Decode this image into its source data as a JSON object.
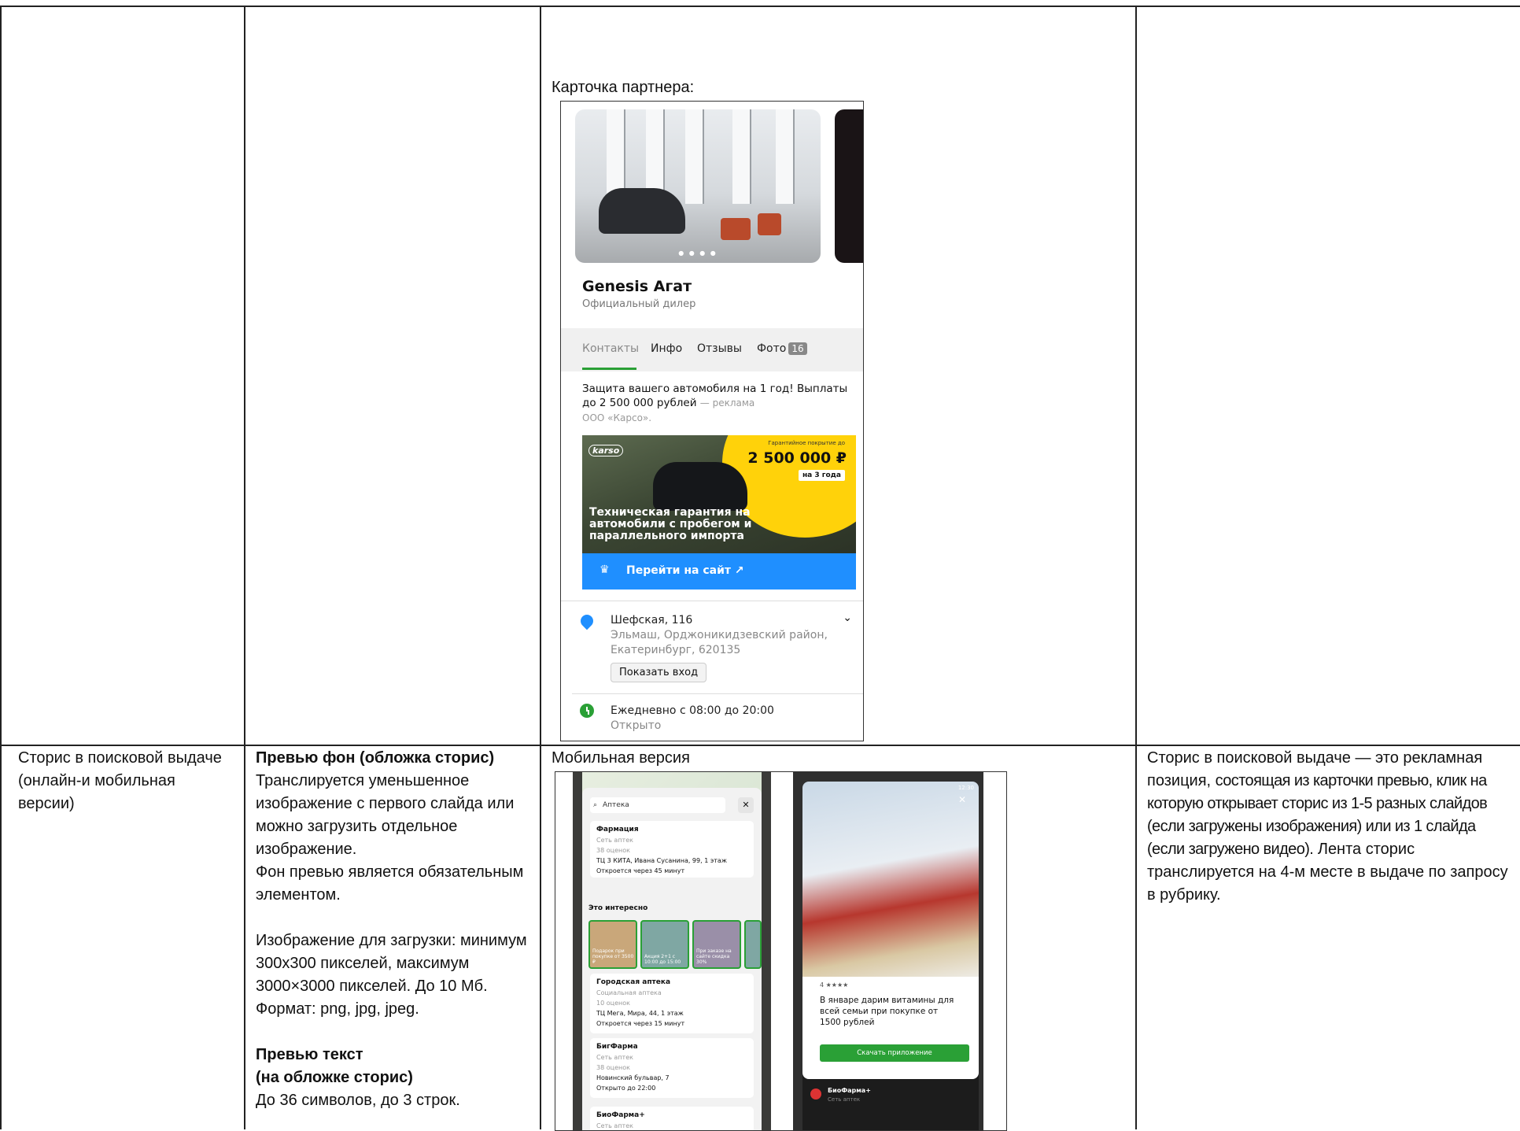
{
  "partner_card_label": "Карточка партнера:",
  "partner": {
    "photo_dots": "● ● ● ●",
    "name": "Genesis Агат",
    "subtitle": "Официальный дилер",
    "tabs": [
      "Контакты",
      "Инфо",
      "Отзывы",
      "Фото"
    ],
    "photo_count": "16",
    "ad_text": "Защита вашего автомобиля на 1 год! Выплаты до 2 500 000 рублей",
    "ad_mark": "— реклама",
    "ad_org": "ООО «Карсо».",
    "banner": {
      "logo": "karso",
      "coverage_label": "Гарантийное покрытие до",
      "sum": "2 500 000 ₽",
      "years": "на 3 года",
      "headline": "Техническая гарантия на автомобили с пробегом и параллельного импорта"
    },
    "cta_label": "Перейти на сайт ↗",
    "address_main": "Шефская, 116",
    "address_sub": "Эльмаш, Орджоникидзевский район, Екатеринбург, 620135",
    "show_entry": "Показать вход",
    "hours": "Ежедневно с 08:00 до 20:00",
    "status": "Открыто"
  },
  "row": {
    "col1": "Сторис в поисковой выдаче (онлайн-и мобильная версии)",
    "col2": {
      "h1": "Превью фон (обложка сторис)",
      "p1": "Транслируется уменьшенное изображение с первого слайда или можно загрузить отдельное изображение.",
      "p2": "Фон превью является обязательным элементом.",
      "p3": "Изображение для загрузки: минимум 300x300 пикселей, максимум 3000×3000 пикселей. До 10 Мб. Формат: png, jpg, jpeg.",
      "h2": "Превью текст",
      "h3": "(на обложке сторис)",
      "p4": "До 36 символов, до 3 строк."
    },
    "col3_label": "Мобильная версия",
    "col4_a": "Сторис в поисковой выдаче — это",
    "col4_b": "рекламная позиция,",
    "col4_c": "состоящая из карточки превью, клик на которую открывает сторис из 1-5 разных слайдов (если загружены изображения) или из 1 слайда (если загружено видео).",
    "col4_d": "Лента сторис транслируется на 4-м месте в выдаче по запросу в рубрику."
  },
  "mobile": {
    "search": "Аптека",
    "close": "✕",
    "card1": {
      "title": "Фармация",
      "type": "Сеть аптек",
      "rating": "38 оценок",
      "address": "ТЦ 3 КИТА, Ивана Сусанина, 99, 1 этаж",
      "open": "Откроется через 45 минут"
    },
    "interesting": "Это интересно",
    "stories": [
      "Подарок при покупке от 3500 ₽",
      "Акция 2+1 с 10:00 до 15:00",
      "При заказе на сайте скидка 30%"
    ],
    "card2": {
      "title": "Городская аптека",
      "type": "Социальная аптека",
      "rating": "10 оценок",
      "address": "ТЦ Мега, Мира, 44, 1 этаж",
      "open": "Откроется через 15 минут"
    },
    "card3": {
      "title": "БигФарма",
      "type": "Сеть аптек",
      "rating": "38 оценок",
      "address": "Новинский бульвар, 7",
      "open": "Открыто до 22:00"
    },
    "card4": {
      "title": "БиоФарма+",
      "type": "Сеть аптек"
    },
    "story": {
      "time": "12:30",
      "close": "✕",
      "stars": "4 ★★★★",
      "text": "В январе дарим витамины для всей семьи при покупке от 1500 рублей",
      "button": "Скачать приложение",
      "brand": "БиоФарма+",
      "brand_sub": "Сеть аптек"
    }
  }
}
